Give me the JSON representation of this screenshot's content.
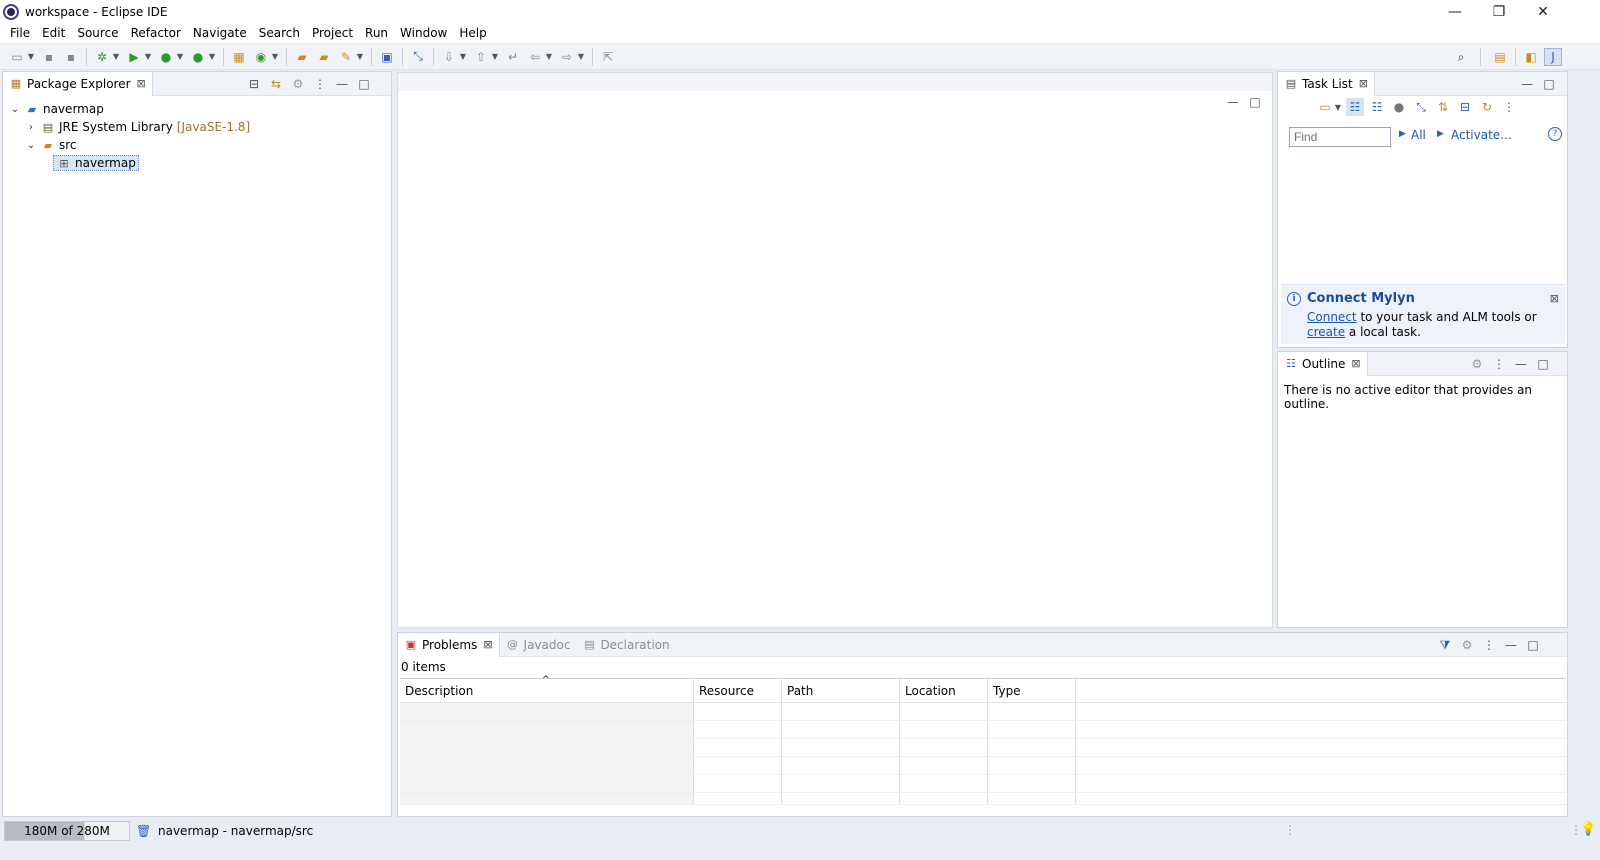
{
  "window": {
    "title": "workspace - Eclipse IDE",
    "controls": [
      "—",
      "❐",
      "✕"
    ]
  },
  "menu": [
    {
      "label": "File"
    },
    {
      "label": "Edit"
    },
    {
      "label": "Source"
    },
    {
      "label": "Refactor"
    },
    {
      "label": "Navigate"
    },
    {
      "label": "Search"
    },
    {
      "label": "Project"
    },
    {
      "label": "Run"
    },
    {
      "label": "Window"
    },
    {
      "label": "Help"
    }
  ],
  "toolbar": {
    "icons": [
      "new-icon",
      "save-icon",
      "save-all-icon",
      "debug-icon",
      "run-icon",
      "coverage-icon",
      "external-tools-icon",
      "new-java-package-icon",
      "new-class-icon",
      "open-type-icon",
      "open-task-icon",
      "search-icon",
      "terminal-icon",
      "skip-breakpoints-icon",
      "next-annotation-icon",
      "prev-annotation-icon",
      "last-edit-icon",
      "back-icon",
      "forward-icon",
      "pin-editor-icon"
    ],
    "right_icons": [
      "search-icon",
      "open-perspective-icon",
      "java-ee-perspective-icon",
      "java-perspective-icon"
    ]
  },
  "package_explorer": {
    "tab_label": "Package Explorer",
    "tree": {
      "project": "navermap",
      "jre": "JRE System Library",
      "jre_decoration": "[JavaSE-1.8]",
      "src": "src",
      "package": "navermap"
    }
  },
  "task_list": {
    "tab_label": "Task List",
    "find_placeholder": "Find",
    "all_label": "All",
    "activate_label": "Activate..."
  },
  "mylyn": {
    "title": "Connect Mylyn",
    "connect_link": "Connect",
    "text_middle": " to your task and ALM tools or ",
    "create_link": "create",
    "text_end": " a local task."
  },
  "outline": {
    "tab_label": "Outline",
    "message": "There is no active editor that provides an outline."
  },
  "bottom": {
    "tabs": [
      {
        "label": "Problems"
      },
      {
        "label": "Javadoc"
      },
      {
        "label": "Declaration"
      }
    ],
    "items_count": "0 items",
    "columns": [
      "Description",
      "Resource",
      "Path",
      "Location",
      "Type"
    ]
  },
  "status": {
    "heap": "180M of 280M",
    "heap_used_fraction": 0.64,
    "selection": "navermap - navermap/src"
  }
}
